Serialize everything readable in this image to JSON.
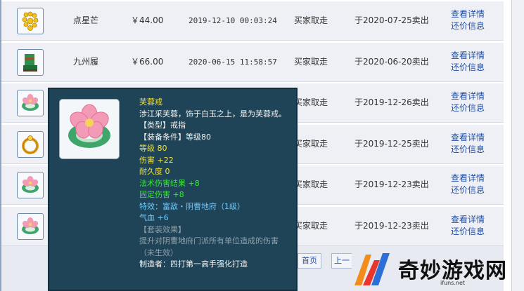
{
  "rows": [
    {
      "name": "点星芒",
      "price": "￥44.00",
      "time": "2019-12-10 00:03:24",
      "status": "买家取走",
      "sold": "于2020-07-25卖出",
      "icon": "gold-bead-necklace-icon"
    },
    {
      "name": "九州履",
      "price": "￥66.00",
      "time": "2020-06-15 11:58:57",
      "status": "买家取走",
      "sold": "于2020-06-20卖出",
      "icon": "green-boots-icon"
    },
    {
      "name": "",
      "price": "",
      "time": "",
      "status": "买家取走",
      "sold": "于2019-12-26卖出",
      "icon": "jade-flower-ring-icon"
    },
    {
      "name": "",
      "price": "",
      "time": "",
      "status": "买家取走",
      "sold": "于2019-12-25卖出",
      "icon": "gold-ring-icon"
    },
    {
      "name": "",
      "price": "",
      "time": "",
      "status": "买家取走",
      "sold": "于2019-12-23卖出",
      "icon": "jade-flower-ring-icon"
    },
    {
      "name": "",
      "price": "",
      "time": "",
      "status": "买家取走",
      "sold": "于2019-12-23卖出",
      "icon": "jade-flower-ring-icon"
    }
  ],
  "row_links": {
    "detail": "查看详情",
    "counter_offer": "还价信息"
  },
  "pager": {
    "first": "首页",
    "prev": "上一"
  },
  "tooltip": {
    "name": "芙蓉戒",
    "desc": "涉江采芙蓉，饰于白玉之上，是为芙蓉戒。",
    "type_line": "【类型】戒指",
    "req_line": "【装备条件】等级80",
    "level": "等级 80",
    "damage": "伤害 +22",
    "durability": "耐久度 0",
    "spell_result": "法术伤害结果 +8",
    "fixed_damage": "固定伤害 +8",
    "effect": "特效：富敌・阴曹地府（1级）",
    "hp": "气血 +6",
    "set_title": "【套装效果】",
    "set_desc": "提升对阴曹地府门派所有单位造成的伤害（未生效）",
    "maker": "制造者：四打第一高手强化打造"
  },
  "watermark": {
    "text": "奇妙游戏网",
    "sub": "ifuns.net"
  },
  "colors": {
    "tooltip_bg": "#1f4457",
    "name_yellow": "#f2e33a",
    "stat_green": "#39e639",
    "effect_cyan": "#6fc9ff",
    "link_blue": "#1f4fa8"
  }
}
